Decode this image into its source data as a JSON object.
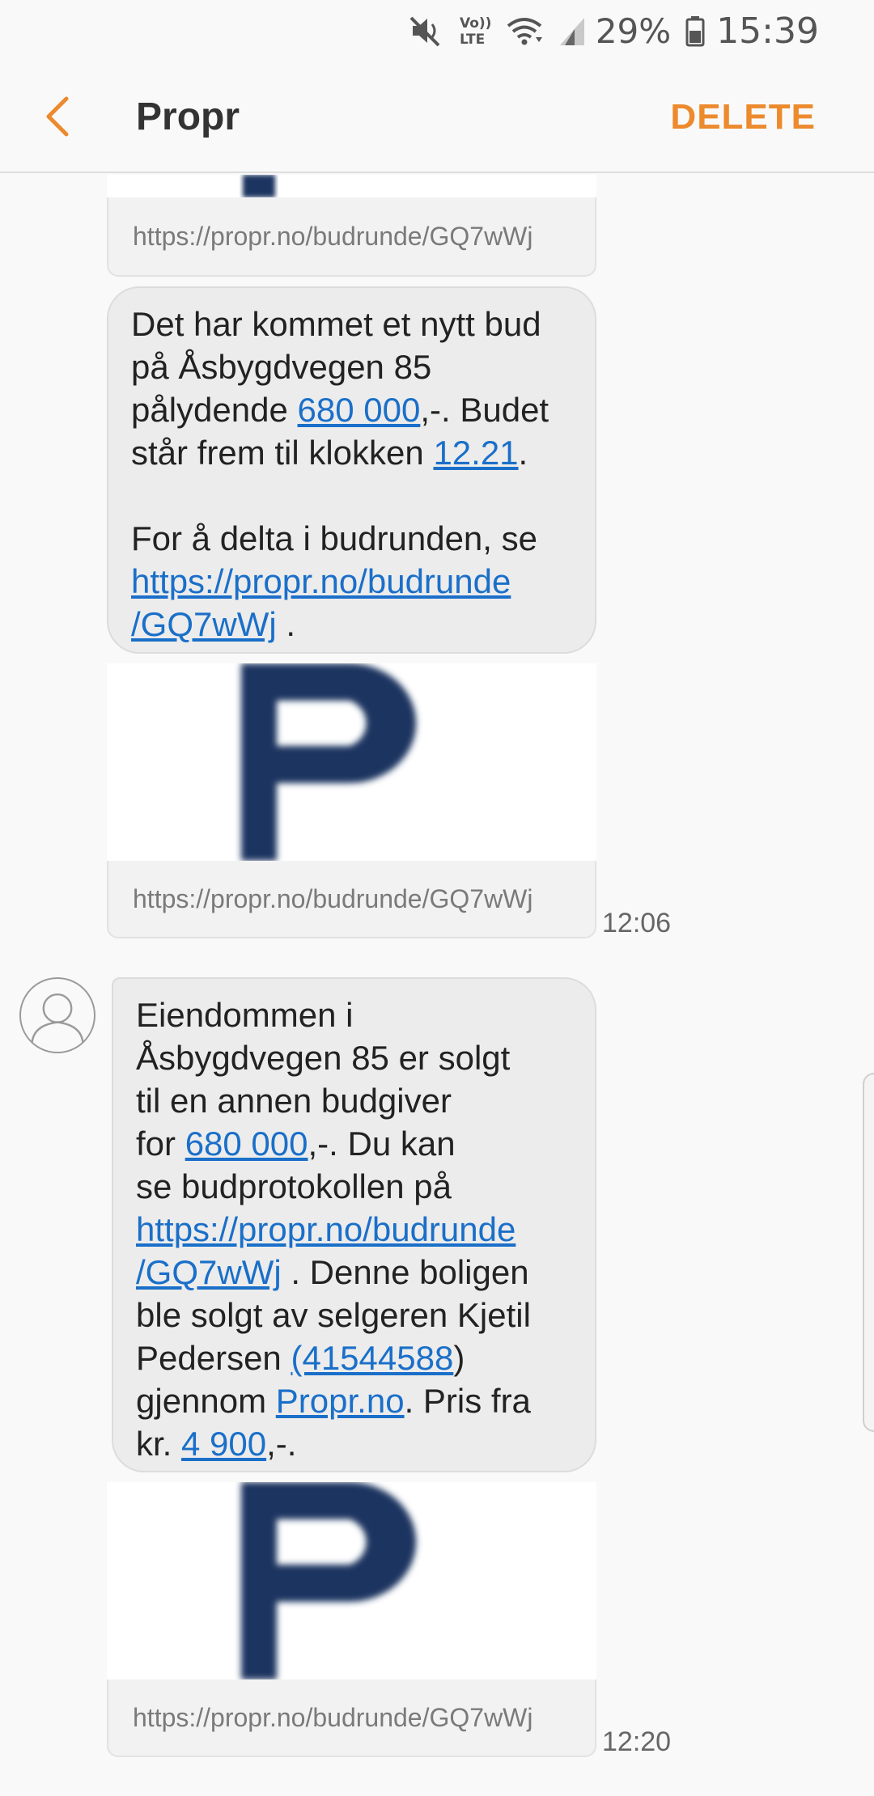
{
  "status_bar": {
    "battery_percent": "29%",
    "clock": "15:39",
    "volte_label_top": "Vo))",
    "volte_label_bottom": "LTE"
  },
  "app_bar": {
    "title": "Propr",
    "delete_label": "DELETE"
  },
  "messages": [
    {
      "preview_url": "https://propr.no/budrunde/GQ7wWj"
    },
    {
      "text": {
        "p1": "Det har kommet et nytt bud på Åsbygdvegen 85 pålydende ",
        "amount": "680 000",
        "p2": ",-. Budet står frem til klokken ",
        "clock_link": "12.21",
        "p3": ".",
        "p4": "For å delta i budrunden, se ",
        "link_line1": "https://propr.no/budrunde",
        "link_line2": "/GQ7wWj",
        "p5": " ."
      },
      "preview_url": "https://propr.no/budrunde/GQ7wWj",
      "time": "12:06"
    },
    {
      "text": {
        "l1": "Eiendommen i",
        "l2": "Åsbygdvegen 85 er solgt",
        "l3": "til en annen budgiver",
        "l4a": "for ",
        "amount": "680 000",
        "l4b": ",-. Du kan",
        "l5": "se budprotokollen på",
        "link_line1": "https://propr.no/budrunde",
        "link_line2": "/GQ7wWj",
        "l6b": " . Denne boligen",
        "l7": "ble solgt av selgeren Kjetil",
        "l8a": "Pedersen ",
        "phone": "(41544588",
        "l8b": ")",
        "l9a": "gjennom ",
        "site": "Propr.no",
        "l9b": ". Pris fra",
        "l10a": "kr. ",
        "price": "4 900",
        "l10b": ",-."
      },
      "preview_url": "https://propr.no/budrunde/GQ7wWj",
      "time": "12:20"
    }
  ],
  "colors": {
    "accent": "#ec8a2d",
    "link": "#1a6fc9",
    "bubble": "#ececec",
    "logo": "#1f3660"
  }
}
